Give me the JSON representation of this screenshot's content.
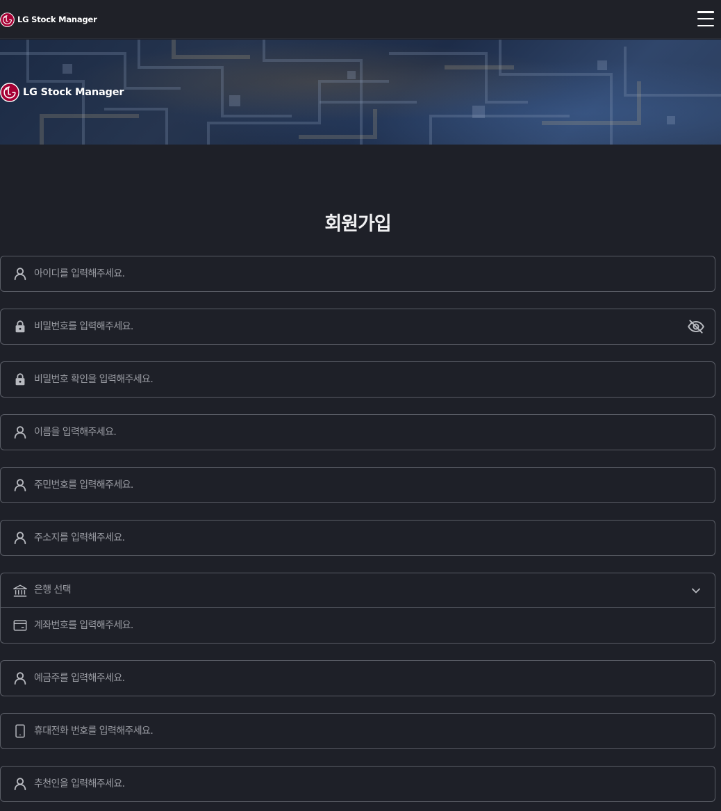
{
  "header": {
    "brand_name": "LG Stock Manager",
    "logo_icon": "lg-logo-icon",
    "menu_icon": "hamburger-menu-icon"
  },
  "hero": {
    "brand_name": "LG Stock Manager"
  },
  "page_title": "회원가입",
  "colors": {
    "background": "#1e2028",
    "field_border": "#5a5d66",
    "placeholder": "#9a9ca3",
    "lg_red": "#a50034",
    "icon": "#b8bac0"
  },
  "form": {
    "user_id": {
      "placeholder": "아이디를 입력해주세요.",
      "icon": "user-icon"
    },
    "password": {
      "placeholder": "비밀번호를 입력해주세요.",
      "icon": "lock-icon",
      "toggle_icon": "eye-off-icon"
    },
    "password_confirm": {
      "placeholder": "비밀번호 확인을 입력해주세요.",
      "icon": "lock-icon"
    },
    "name": {
      "placeholder": "이름을 입력해주세요.",
      "icon": "user-icon"
    },
    "resident_number": {
      "placeholder": "주민번호를 입력해주세요.",
      "icon": "user-icon"
    },
    "address": {
      "placeholder": "주소지를 입력해주세요.",
      "icon": "user-icon"
    },
    "bank": {
      "selected": "은행 선택",
      "icon": "bank-icon",
      "chevron_icon": "chevron-down-icon"
    },
    "account_number": {
      "placeholder": "계좌번호를 입력해주세요.",
      "icon": "card-icon"
    },
    "account_holder": {
      "placeholder": "예금주를 입력해주세요.",
      "icon": "user-icon"
    },
    "phone": {
      "placeholder": "휴대전화 번호를 입력해주세요.",
      "icon": "mobile-icon"
    },
    "referrer": {
      "placeholder": "추천인을 입력해주세요.",
      "icon": "user-icon"
    }
  }
}
